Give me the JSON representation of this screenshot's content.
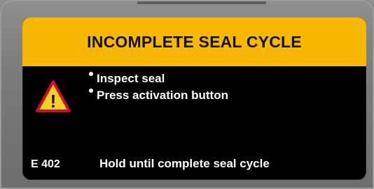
{
  "banner": {
    "title": "INCOMPLETE SEAL CYCLE",
    "color": "#f8b800"
  },
  "warning": {
    "icon": "warning-triangle-icon",
    "symbol": "!",
    "fill_color": "#f8d020",
    "border_color": "#c8102e"
  },
  "instructions": {
    "items": [
      {
        "label": "Inspect seal"
      },
      {
        "label": "Press activation button"
      }
    ]
  },
  "footer": {
    "error_code": "E 402",
    "message": "Hold until complete seal cycle"
  },
  "colors": {
    "screen_background": "#000000",
    "text": "#ffffff",
    "bezel": "#7a7a7a"
  }
}
